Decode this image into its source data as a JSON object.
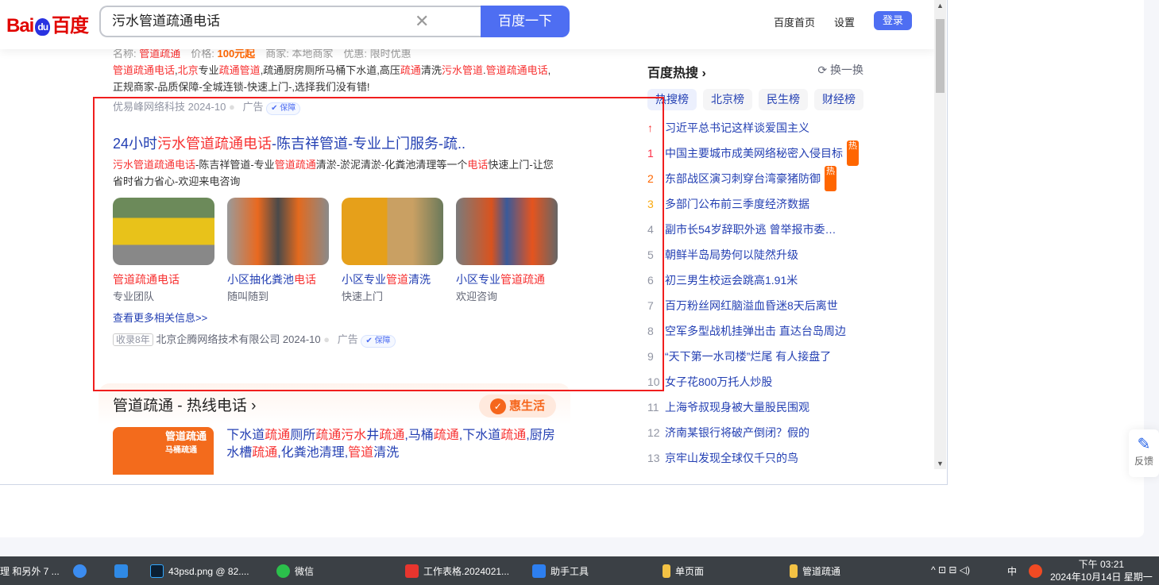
{
  "header": {
    "logo": "Bai du 百度",
    "query": "污水管道疏通电话",
    "search_button": "百度一下",
    "nav_home": "百度首页",
    "nav_settings": "设置",
    "login": "登录"
  },
  "prev_result": {
    "info": [
      {
        "t": "名称: "
      },
      {
        "t": "管道疏通",
        "hl": 1
      },
      {
        "t": "　价格: "
      },
      {
        "t": "100元起",
        "hl": 2
      },
      {
        "t": "　商家: 本地商家　优惠: 限时优惠"
      }
    ],
    "desc": [
      {
        "t": "管道疏通电话",
        "hl": 1
      },
      {
        "t": ","
      },
      {
        "t": "北京",
        "hl": 1
      },
      {
        "t": "专业"
      },
      {
        "t": "疏通管道",
        "hl": 1
      },
      {
        "t": ",疏通厨房厕所马桶下水道,高压"
      },
      {
        "t": "疏通",
        "hl": 1
      },
      {
        "t": "清洗"
      },
      {
        "t": "污水管道",
        "hl": 1
      },
      {
        "t": "."
      },
      {
        "t": "管道疏通电话",
        "hl": 1
      },
      {
        "t": ",正规商家-品质保障-全城连锁-快速上门-,选择我们没有错!"
      }
    ],
    "source": "优易峰网络科技 2024-10",
    "ad": "广告",
    "guarantee": "保障"
  },
  "result": {
    "title": [
      {
        "t": "24小时"
      },
      {
        "t": "污水管道疏通电话",
        "hl": 1
      },
      {
        "t": "-陈吉祥管道-专业上门服务-疏.."
      }
    ],
    "desc": [
      {
        "t": "污水管道疏通电话",
        "hl": 1
      },
      {
        "t": "-陈吉祥管道-专业"
      },
      {
        "t": "管道疏通",
        "hl": 1
      },
      {
        "t": "清淤-淤泥清淤-化粪池清理等一个"
      },
      {
        "t": "电话",
        "hl": 1
      },
      {
        "t": "快速上门-让您省时省力省心-欢迎来电咨询"
      }
    ],
    "cards": [
      {
        "caption": [
          {
            "t": "管道疏通电话",
            "hl": 1
          }
        ],
        "sub": "专业团队"
      },
      {
        "caption": [
          {
            "t": "小区抽化粪池"
          },
          {
            "t": "电话",
            "hl": 1
          }
        ],
        "sub": "随叫随到"
      },
      {
        "caption": [
          {
            "t": "小区专业"
          },
          {
            "t": "管道",
            "hl": 1
          },
          {
            "t": "清洗"
          }
        ],
        "sub": "快速上门"
      },
      {
        "caption": [
          {
            "t": "小区专业"
          },
          {
            "t": "管道疏通",
            "hl": 1
          }
        ],
        "sub": "欢迎咨询"
      }
    ],
    "more": "查看更多相关信息>>",
    "record": "收录8年",
    "source": "北京企腾网络技术有限公司 2024-10",
    "ad": "广告",
    "guarantee": "保障"
  },
  "service": {
    "title": "管道疏通 - 热线电话 ›",
    "brand": "惠生活",
    "thumb_text": "管道疏通",
    "thumb_sub": "马桶疏通",
    "desc": [
      {
        "t": "下水道"
      },
      {
        "t": "疏通",
        "hl": 1
      },
      {
        "t": "厕所"
      },
      {
        "t": "疏通污水",
        "hl": 1
      },
      {
        "t": "井"
      },
      {
        "t": "疏通",
        "hl": 1
      },
      {
        "t": ",马桶"
      },
      {
        "t": "疏通",
        "hl": 1
      },
      {
        "t": ",下水道"
      },
      {
        "t": "疏通",
        "hl": 1
      },
      {
        "t": ",厨房水槽"
      },
      {
        "t": "疏通",
        "hl": 1
      },
      {
        "t": ",化粪池清理,"
      },
      {
        "t": "管道",
        "hl": 1
      },
      {
        "t": "清洗"
      }
    ]
  },
  "hot": {
    "title": "百度热搜 ›",
    "refresh": "换一换",
    "tabs": [
      "热搜榜",
      "北京榜",
      "民生榜",
      "财经榜"
    ],
    "items": [
      {
        "rank": "↑",
        "text": "习近平总书记这样谈爱国主义",
        "color": "#f73131"
      },
      {
        "rank": "1",
        "text": "中国主要城市成美网络秘密入侵目标",
        "tag": "热",
        "color": "#fe2d46"
      },
      {
        "rank": "2",
        "text": "东部战区演习刺穿台湾豪猪防御",
        "tag": "热",
        "color": "#f60"
      },
      {
        "rank": "3",
        "text": "多部门公布前三季度经济数据",
        "color": "#faa90e"
      },
      {
        "rank": "4",
        "text": "副市长54岁辞职外逃 曾举报市委…"
      },
      {
        "rank": "5",
        "text": "朝鲜半岛局势何以陡然升级"
      },
      {
        "rank": "6",
        "text": "初三男生校运会跳高1.91米"
      },
      {
        "rank": "7",
        "text": "百万粉丝网红脑溢血昏迷8天后离世"
      },
      {
        "rank": "8",
        "text": "空军多型战机挂弹出击 直达台岛周边"
      },
      {
        "rank": "9",
        "text": "“天下第一水司楼”烂尾 有人接盘了"
      },
      {
        "rank": "10",
        "text": "女子花800万托人炒股"
      },
      {
        "rank": "11",
        "text": "上海爷叔现身被大量股民围观"
      },
      {
        "rank": "12",
        "text": "济南某银行将破产倒闭？假的"
      },
      {
        "rank": "13",
        "text": "京牢山发现全球仅千只的鸟"
      }
    ]
  },
  "feedback": "反馈",
  "taskbar": {
    "items": [
      "理 和另外 7 ...",
      "43psd.png @ 82....",
      "微信",
      "工作表格.2024021...",
      "助手工具",
      "单页面",
      "管道疏通"
    ],
    "ime": "中",
    "time": "下午 03:21",
    "date": "2024年10月14日 星期一"
  }
}
